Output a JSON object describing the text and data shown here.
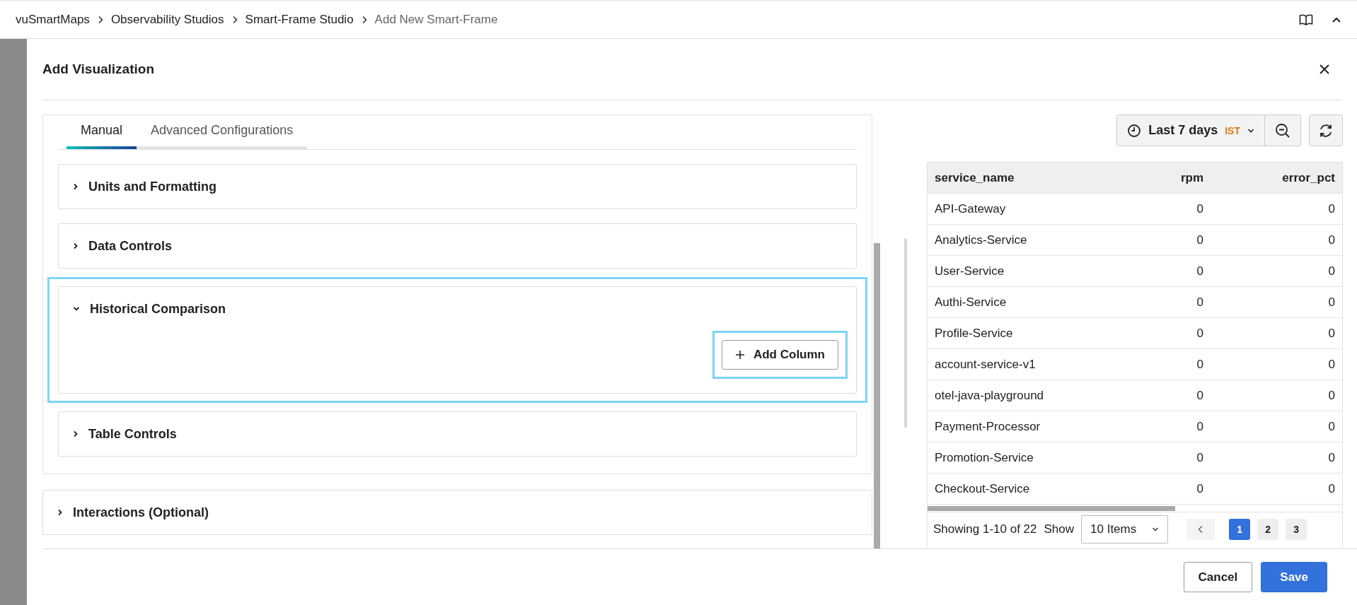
{
  "breadcrumbs": [
    {
      "label": "vuSmartMaps",
      "current": false
    },
    {
      "label": "Observability Studios",
      "current": false
    },
    {
      "label": "Smart-Frame Studio",
      "current": false
    },
    {
      "label": "Add New Smart-Frame",
      "current": true
    }
  ],
  "modal": {
    "title": "Add Visualization"
  },
  "tabs": [
    {
      "label": "Manual",
      "selected": true
    },
    {
      "label": "Advanced Configurations",
      "selected": false
    }
  ],
  "sections": [
    {
      "title": "Units and Formatting",
      "expanded": false,
      "highlighted": false
    },
    {
      "title": "Data Controls",
      "expanded": false,
      "highlighted": false
    },
    {
      "title": "Historical Comparison",
      "expanded": true,
      "highlighted": true,
      "button": {
        "label": "Add Column",
        "highlighted": true
      }
    },
    {
      "title": "Table Controls",
      "expanded": false,
      "highlighted": false
    }
  ],
  "interactions": {
    "title": "Interactions (Optional)",
    "expanded": false
  },
  "time_picker": {
    "label": "Last 7 days",
    "timezone": "IST"
  },
  "table": {
    "columns": [
      {
        "label": "service_name"
      },
      {
        "label": "rpm"
      },
      {
        "label": "error_pct"
      }
    ],
    "rows": [
      [
        "API-Gateway",
        "0",
        "0"
      ],
      [
        "Analytics-Service",
        "0",
        "0"
      ],
      [
        "User-Service",
        "0",
        "0"
      ],
      [
        "Authi-Service",
        "0",
        "0"
      ],
      [
        "Profile-Service",
        "0",
        "0"
      ],
      [
        "account-service-v1",
        "0",
        "0"
      ],
      [
        "otel-java-playground",
        "0",
        "0"
      ],
      [
        "Payment-Processor",
        "0",
        "0"
      ],
      [
        "Promotion-Service",
        "0",
        "0"
      ],
      [
        "Checkout-Service",
        "0",
        "0"
      ]
    ]
  },
  "pagination": {
    "summary": "Showing 1-10 of 22",
    "show_label": "Show",
    "page_size": "10 Items",
    "pages": [
      {
        "label": "1",
        "selected": true
      },
      {
        "label": "2",
        "selected": false
      },
      {
        "label": "3",
        "selected": false
      }
    ]
  },
  "footer": {
    "buttons": [
      {
        "label": "Cancel",
        "kind": "secondary"
      },
      {
        "label": "Save",
        "kind": "primary"
      }
    ]
  }
}
